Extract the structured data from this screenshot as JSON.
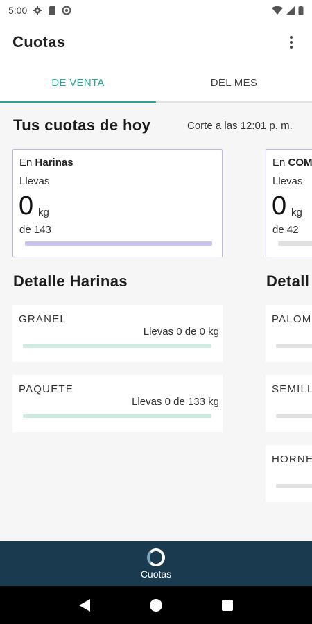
{
  "status_bar": {
    "time": "5:00",
    "left_icons": [
      "gear-icon",
      "sd-card-icon",
      "sync-icon"
    ],
    "right_icons": [
      "wifi-icon",
      "signal-icon",
      "battery-icon"
    ]
  },
  "app_bar": {
    "title": "Cuotas",
    "menu_icon": "more-vert-icon"
  },
  "tabs": [
    {
      "label": "DE VENTA",
      "active": true
    },
    {
      "label": "DEL MES",
      "active": false
    }
  ],
  "today": {
    "title": "Tus cuotas de hoy",
    "cutoff": "Corte a las 12:01 p. m."
  },
  "quota_cards": [
    {
      "prefix": "En",
      "category": "Harinas",
      "carry_label": "Llevas",
      "amount": "0",
      "unit": "kg",
      "of_text": "de 143",
      "progress": 0
    },
    {
      "prefix": "En",
      "category": "COM",
      "carry_label": "Llevas",
      "amount": "0",
      "unit": "kg",
      "of_text": "de 42",
      "progress": 0
    }
  ],
  "detail_columns": [
    {
      "title": "Detalle Harinas",
      "items": [
        {
          "name": "GRANEL",
          "progress_text": "Llevas 0 de 0 kg",
          "progress": 0
        },
        {
          "name": "PAQUETE",
          "progress_text": "Llevas 0 de 133 kg",
          "progress": 0
        }
      ]
    },
    {
      "title": "Detall",
      "items": [
        {
          "name": "PALOM",
          "progress": 0
        },
        {
          "name": "SEMILL",
          "progress": 0
        },
        {
          "name": "HORNE",
          "progress": 0
        }
      ]
    }
  ],
  "bottom_nav": {
    "label": "Cuotas",
    "icon": "quota-ring-icon"
  },
  "system_nav": {
    "back_icon": "back-triangle-icon",
    "home_icon": "home-circle-icon",
    "recents_icon": "recents-square-icon"
  },
  "colors": {
    "accent": "#26a69a",
    "card_border": "#bfb6e0",
    "card_bar": "#c9c2ea",
    "detail_bar": "#cfe9e3",
    "bottom_nav_bg": "#1a3a4f"
  }
}
